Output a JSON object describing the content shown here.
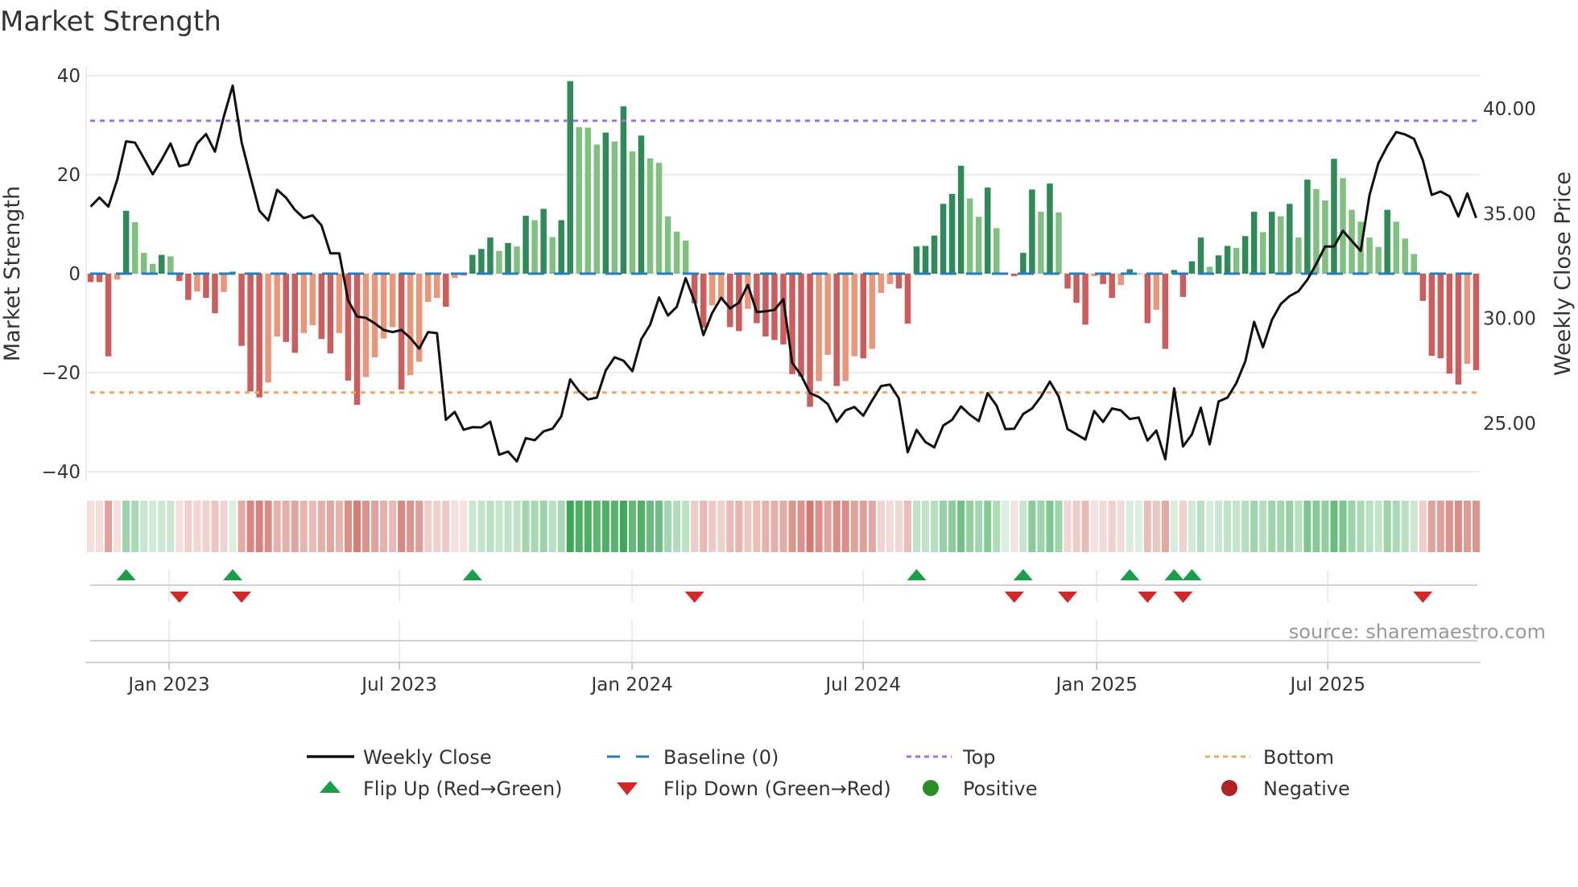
{
  "title": "Market Strength",
  "source": "source: sharemaestro.com",
  "colors": {
    "close": "#111111",
    "baseline": "#2b7bb9",
    "top": "#a070e0",
    "bottom": "#f0a868",
    "pos_dark": "#2e8b57",
    "pos_light": "#80c080",
    "neg_dark": "#cd5c5c",
    "neg_light": "#e9967a",
    "flip_up": "#1a9e4a",
    "flip_down": "#d62728",
    "positive": "#2a8f2a",
    "negative": "#b22222"
  },
  "legend": [
    {
      "key": "close",
      "label": "Weekly Close"
    },
    {
      "key": "baseline",
      "label": "Baseline (0)"
    },
    {
      "key": "top",
      "label": "Top"
    },
    {
      "key": "bottom",
      "label": "Bottom"
    },
    {
      "key": "flip_up",
      "label": "Flip Up (Red→Green)"
    },
    {
      "key": "flip_down",
      "label": "Flip Down (Green→Red)"
    },
    {
      "key": "positive",
      "label": "Positive"
    },
    {
      "key": "negative",
      "label": "Negative"
    }
  ],
  "chart_data": {
    "type": "bar",
    "title": "Market Strength",
    "ylabel": "Market Strength",
    "y2label": "Weekly Close Price",
    "ylim": [
      -40,
      40
    ],
    "y2lim": [
      22.7,
      41.57
    ],
    "yticks": [
      "40",
      "20",
      "0",
      "−20",
      "−40"
    ],
    "ytick_values": [
      40,
      20,
      0,
      -20,
      -40
    ],
    "y2ticks": [
      "40.00",
      "35.00",
      "30.00",
      "25.00"
    ],
    "y2tick_values": [
      40,
      35,
      30,
      25
    ],
    "top_level": 30.9,
    "bottom_level": -24.0,
    "baseline": 0,
    "x_ticks": [
      {
        "label": "Jan 2023",
        "week": 9.84
      },
      {
        "label": "Jul 2023",
        "week": 35.77
      },
      {
        "label": "Jan 2024",
        "week": 61.97
      },
      {
        "label": "Jul 2024",
        "week": 87.99
      },
      {
        "label": "Jan 2025",
        "week": 114.28
      },
      {
        "label": "Jul 2025",
        "week": 140.3
      }
    ],
    "strength": [
      -1.7,
      -1.7,
      -16.7,
      -1.2,
      12.7,
      10.4,
      4.2,
      2.0,
      3.8,
      3.5,
      -1.5,
      -5.3,
      -3.6,
      -4.9,
      -8.0,
      -3.7,
      0.4,
      -14.6,
      -23.8,
      -25.0,
      -22.0,
      -12.7,
      -13.8,
      -16.0,
      -12.0,
      -10.4,
      -13.2,
      -16.1,
      -12.0,
      -21.6,
      -26.5,
      -20.9,
      -16.9,
      -13.1,
      -10.8,
      -23.4,
      -20.5,
      -17.8,
      -5.7,
      -4.9,
      -6.7,
      -0.9,
      -0.4,
      3.8,
      5.0,
      7.3,
      4.6,
      6.2,
      5.5,
      11.7,
      10.8,
      13.1,
      7.4,
      10.8,
      38.9,
      29.6,
      29.5,
      26.1,
      28.5,
      26.7,
      33.8,
      24.7,
      27.9,
      23.3,
      22.4,
      11.6,
      8.5,
      6.7,
      -6.0,
      -10.9,
      -6.4,
      -5.3,
      -10.8,
      -11.6,
      -7.1,
      -10.0,
      -12.7,
      -13.4,
      -14.3,
      -20.3,
      -20.8,
      -26.9,
      -21.7,
      -16.4,
      -22.7,
      -21.7,
      -16.7,
      -17.1,
      -15.2,
      -3.9,
      -2.1,
      -3.0,
      -10.1,
      5.5,
      5.6,
      7.7,
      14.1,
      16.1,
      21.8,
      15.2,
      11.5,
      17.4,
      9.2,
      0.1,
      -0.5,
      4.2,
      17.0,
      12.5,
      18.2,
      12.4,
      -3.0,
      -5.9,
      -10.3,
      -0.5,
      -2.1,
      -4.9,
      -2.3,
      0.9,
      0.1,
      -10.0,
      -7.3,
      -15.2,
      0.75,
      -4.7,
      2.5,
      7.3,
      1.4,
      3.7,
      5.6,
      5.2,
      7.6,
      12.5,
      8.4,
      12.5,
      11.6,
      14.1,
      7.3,
      19.0,
      17.1,
      14.8,
      23.2,
      19.3,
      12.9,
      10.5,
      7.3,
      5.4,
      12.9,
      10.5,
      7.1,
      4.0,
      -5.5,
      -16.6,
      -17.1,
      -20.2,
      -22.4,
      -18.2,
      -19.5
    ],
    "weekly_close": [
      35.33,
      35.76,
      35.33,
      36.61,
      38.44,
      38.38,
      37.63,
      36.87,
      37.57,
      38.34,
      37.25,
      37.35,
      38.34,
      38.79,
      37.95,
      39.62,
      41.09,
      38.4,
      36.74,
      35.14,
      34.67,
      36.13,
      35.76,
      35.18,
      34.78,
      34.91,
      34.44,
      33.1,
      33.1,
      30.86,
      30.09,
      30.03,
      29.77,
      29.45,
      29.35,
      29.45,
      29.07,
      28.56,
      29.35,
      29.3,
      25.17,
      25.55,
      24.7,
      24.82,
      24.81,
      25.08,
      23.51,
      23.66,
      23.19,
      24.3,
      24.2,
      24.62,
      24.75,
      25.34,
      27.1,
      26.53,
      26.14,
      26.23,
      27.53,
      28.15,
      27.99,
      27.49,
      29.01,
      29.7,
      31.0,
      30.14,
      30.55,
      31.92,
      30.82,
      29.21,
      30.27,
      30.99,
      30.48,
      30.75,
      31.6,
      30.3,
      30.34,
      30.41,
      30.92,
      27.88,
      27.29,
      26.44,
      26.26,
      25.92,
      25.07,
      25.62,
      25.78,
      25.37,
      26.1,
      26.78,
      26.85,
      26.19,
      23.63,
      24.69,
      24.11,
      23.86,
      24.9,
      25.17,
      25.81,
      25.41,
      25.11,
      26.44,
      25.85,
      24.73,
      24.75,
      25.45,
      25.71,
      26.27,
      26.99,
      26.28,
      24.73,
      24.48,
      24.23,
      25.59,
      25.07,
      25.71,
      25.62,
      25.21,
      25.28,
      24.18,
      24.66,
      23.29,
      26.67,
      23.9,
      24.48,
      25.75,
      24.0,
      26.05,
      26.23,
      26.92,
      27.95,
      29.84,
      28.63,
      29.93,
      30.69,
      31.07,
      31.3,
      31.85,
      32.6,
      33.43,
      33.43,
      34.18,
      33.7,
      33.22,
      35.89,
      37.4,
      38.22,
      38.88,
      38.77,
      38.56,
      37.54,
      35.89,
      36.05,
      35.82,
      34.86,
      35.96,
      34.79
    ],
    "flip_up_weeks": [
      5,
      17,
      44,
      94,
      106,
      118,
      123,
      125
    ],
    "flip_down_weeks": [
      11,
      18,
      69,
      105,
      111,
      120,
      124,
      151
    ],
    "grid": true,
    "legend_position": "bottom"
  }
}
